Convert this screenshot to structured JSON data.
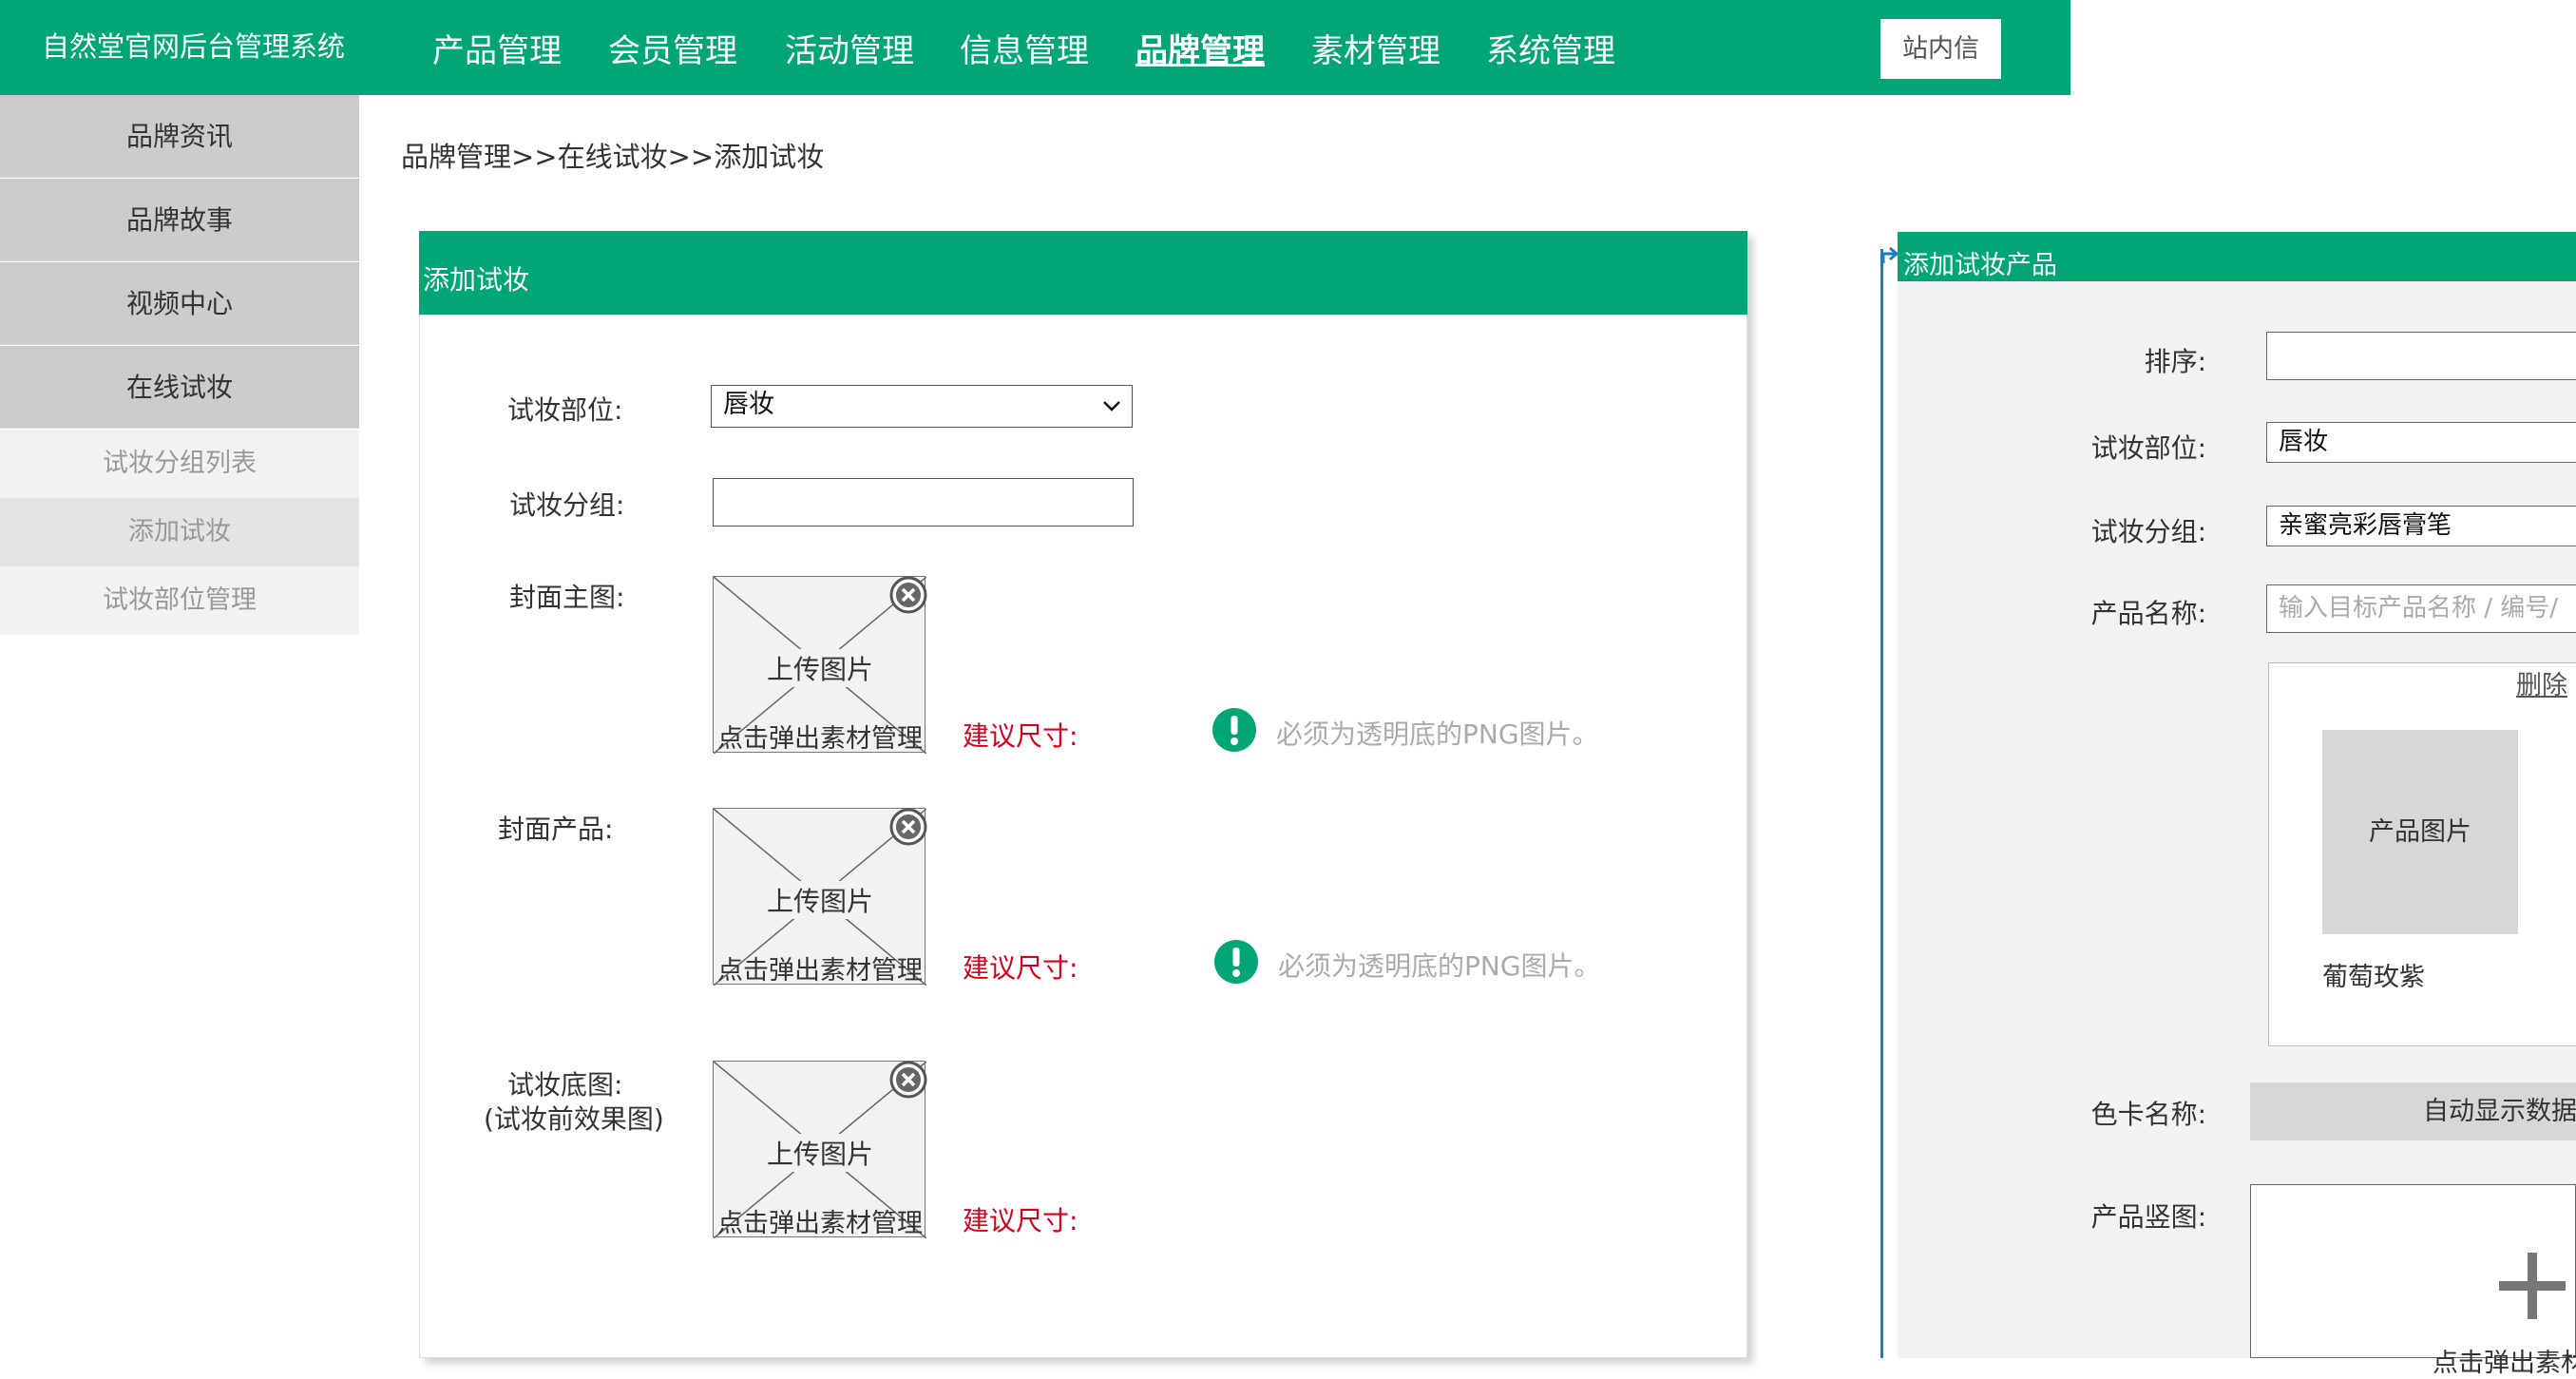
{
  "header": {
    "system_title": "自然堂官网后台管理系统",
    "nav": [
      {
        "label": "产品管理",
        "active": false
      },
      {
        "label": "会员管理",
        "active": false
      },
      {
        "label": "活动管理",
        "active": false
      },
      {
        "label": "信息管理",
        "active": false
      },
      {
        "label": "品牌管理",
        "active": true
      },
      {
        "label": "素材管理",
        "active": false
      },
      {
        "label": "系统管理",
        "active": false
      }
    ],
    "message_button": "站内信"
  },
  "sidebar": {
    "items": [
      {
        "label": "品牌资讯"
      },
      {
        "label": "品牌故事"
      },
      {
        "label": "视频中心"
      },
      {
        "label": "在线试妆"
      }
    ],
    "sub_items": [
      {
        "label": "试妆分组列表"
      },
      {
        "label": "添加试妆"
      },
      {
        "label": "试妆部位管理"
      }
    ]
  },
  "breadcrumb": "品牌管理>>在线试妆>>添加试妆",
  "form": {
    "title": "添加试妆",
    "part_label": "试妆部位:",
    "part_value": "唇妆",
    "group_label": "试妆分组:",
    "group_value": "",
    "cover_main_label": "封面主图:",
    "cover_product_label": "封面产品:",
    "base_image_label": "试妆底图:",
    "base_image_label_2": "(试妆前效果图)",
    "upload_label": "上传图片",
    "upload_sub": "点击弹出素材管理",
    "size_hint": "建议尺寸:",
    "png_hint": "必须为透明底的PNG图片。"
  },
  "product_panel": {
    "title": "添加试妆产品",
    "order_label": "排序:",
    "order_value": "",
    "part_label": "试妆部位:",
    "part_value": "唇妆",
    "group_label": "试妆分组:",
    "group_value": "亲蜜亮彩唇膏笔",
    "name_label": "产品名称:",
    "name_placeholder": "输入目标产品名称 / 编号/",
    "delete_label": "删除",
    "product_image_label": "产品图片",
    "product_name": "葡萄玫紫",
    "color_card_label": "色卡名称:",
    "color_card_value": "自动显示数据",
    "vertical_image_label": "产品竖图:",
    "vertical_sub": "点击弹出素材"
  },
  "colors": {
    "brand_green": "#00a676",
    "sidebar_gray": "#cccccc",
    "hint_red": "#d9001b",
    "connector_blue": "#1a7fbf"
  }
}
